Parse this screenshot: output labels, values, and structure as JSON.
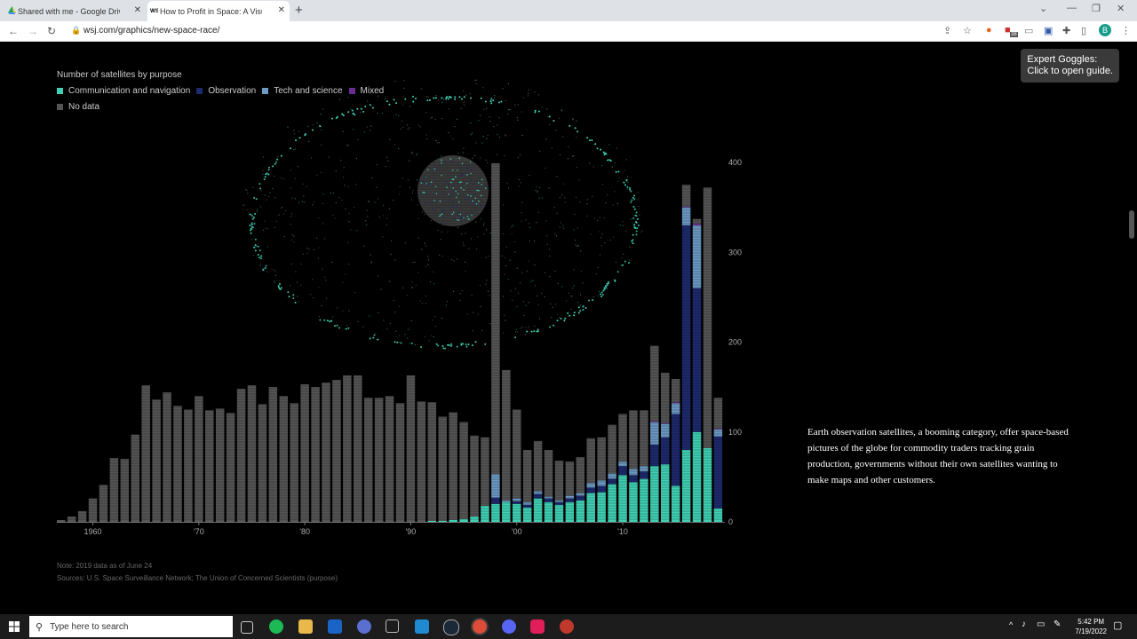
{
  "browser": {
    "tabs": [
      {
        "title": "Shared with me - Google Drive"
      },
      {
        "title": "How to Profit in Space: A Visual..."
      }
    ],
    "url": "wsj.com/graphics/new-space-race/",
    "new_tab_glyph": "+",
    "extension_badge": "38",
    "profile_initial": "B"
  },
  "legend": {
    "title": "Number of satellites by purpose",
    "items": [
      {
        "label": "Communication and navigation",
        "color": "#3fd1b5"
      },
      {
        "label": "Observation",
        "color": "#1d2a6e"
      },
      {
        "label": "Tech and science",
        "color": "#6b9ac4"
      },
      {
        "label": "Mixed",
        "color": "#6a2d8f"
      },
      {
        "label": "No data",
        "color": "#555555"
      }
    ]
  },
  "chart_data": {
    "type": "bar",
    "stacked": true,
    "x_tick_labels": [
      "1960",
      "'70",
      "'80",
      "'90",
      "'00",
      "'10"
    ],
    "y_tick_labels": [
      "400",
      "300",
      "200",
      "100",
      "0"
    ],
    "ylim": [
      0,
      400
    ],
    "years": [
      1957,
      1958,
      1959,
      1960,
      1961,
      1962,
      1963,
      1964,
      1965,
      1966,
      1967,
      1968,
      1969,
      1970,
      1971,
      1972,
      1973,
      1974,
      1975,
      1976,
      1977,
      1978,
      1979,
      1980,
      1981,
      1982,
      1983,
      1984,
      1985,
      1986,
      1987,
      1988,
      1989,
      1990,
      1991,
      1992,
      1993,
      1994,
      1995,
      1996,
      1997,
      1998,
      1999,
      2000,
      2001,
      2002,
      2003,
      2004,
      2005,
      2006,
      2007,
      2008,
      2009,
      2010,
      2011,
      2012,
      2013,
      2014,
      2015,
      2016,
      2017,
      2018,
      2019
    ],
    "series": [
      {
        "name": "Communication and navigation",
        "values": [
          0,
          0,
          0,
          0,
          0,
          0,
          0,
          0,
          0,
          0,
          0,
          0,
          0,
          0,
          0,
          0,
          0,
          0,
          0,
          0,
          0,
          0,
          0,
          0,
          0,
          0,
          0,
          0,
          0,
          0,
          0,
          0,
          0,
          0,
          0,
          1,
          1,
          2,
          3,
          6,
          18,
          20,
          22,
          20,
          16,
          26,
          22,
          19,
          22,
          24,
          32,
          33,
          42,
          52,
          44,
          48,
          62,
          64,
          40,
          80,
          100,
          82,
          15
        ]
      },
      {
        "name": "Observation",
        "values": [
          0,
          0,
          0,
          0,
          0,
          0,
          0,
          0,
          0,
          0,
          0,
          0,
          0,
          0,
          0,
          0,
          0,
          0,
          0,
          0,
          0,
          0,
          0,
          0,
          0,
          0,
          0,
          0,
          0,
          0,
          0,
          0,
          0,
          0,
          0,
          0,
          0,
          0,
          0,
          0,
          0,
          7,
          0,
          3,
          3,
          5,
          4,
          3,
          4,
          5,
          6,
          7,
          6,
          10,
          8,
          8,
          24,
          30,
          80,
          250,
          160,
          0,
          80
        ]
      },
      {
        "name": "Tech and science",
        "values": [
          0,
          0,
          0,
          0,
          0,
          0,
          0,
          0,
          0,
          0,
          0,
          0,
          0,
          0,
          0,
          0,
          0,
          0,
          0,
          0,
          0,
          0,
          0,
          0,
          0,
          0,
          0,
          0,
          0,
          0,
          0,
          0,
          0,
          0,
          0,
          0,
          0,
          0,
          0,
          0,
          0,
          26,
          2,
          3,
          3,
          3,
          2,
          2,
          3,
          3,
          5,
          6,
          6,
          5,
          7,
          6,
          25,
          15,
          12,
          20,
          70,
          0,
          8
        ]
      },
      {
        "name": "Mixed",
        "values": [
          0,
          0,
          0,
          0,
          0,
          0,
          0,
          0,
          0,
          0,
          0,
          0,
          0,
          0,
          0,
          0,
          0,
          0,
          0,
          0,
          0,
          0,
          0,
          0,
          0,
          0,
          0,
          0,
          0,
          0,
          0,
          0,
          0,
          0,
          0,
          0,
          0,
          0,
          0,
          0,
          0,
          0,
          0,
          0,
          0,
          0,
          0,
          0,
          0,
          0,
          0,
          0,
          0,
          0,
          0,
          0,
          1,
          1,
          1,
          1,
          2,
          0,
          1
        ]
      },
      {
        "name": "No data",
        "values": [
          2,
          6,
          12,
          26,
          41,
          71,
          70,
          97,
          152,
          136,
          144,
          129,
          125,
          140,
          124,
          126,
          121,
          148,
          152,
          131,
          150,
          140,
          132,
          153,
          150,
          155,
          158,
          163,
          163,
          138,
          138,
          140,
          132,
          163,
          134,
          132,
          116,
          120,
          108,
          90,
          76,
          346,
          145,
          99,
          58,
          56,
          52,
          44,
          38,
          40,
          50,
          48,
          54,
          53,
          65,
          62,
          84,
          56,
          26,
          24,
          5,
          290,
          34
        ]
      }
    ]
  },
  "notes": {
    "note": "Note: 2019 data as of June 24",
    "sources": "Sources: U.S. Space Surveillance Network; The Union of Concerned Scientists (purpose)"
  },
  "story_text": "Earth observation satellites, a booming category, offer space-based pictures of the globe for commodity traders tracking grain production, governments without their own satellites wanting to make maps and other customers.",
  "goggles": {
    "line1": "Expert Goggles:",
    "line2": "Click to open guide."
  },
  "taskbar": {
    "search_placeholder": "Type here to search",
    "time": "5:42 PM",
    "date": "7/19/2022"
  }
}
